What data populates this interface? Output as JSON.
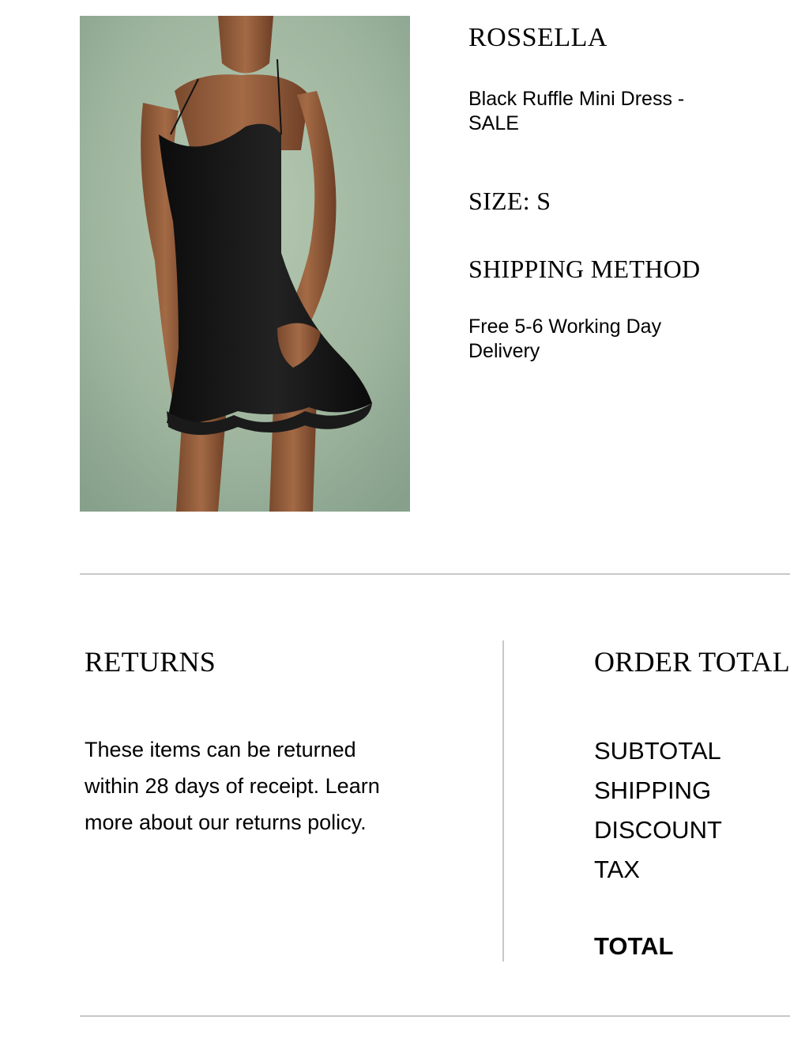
{
  "product": {
    "brand": "ROSSELLA",
    "name": "Black Ruffle Mini Dress - SALE",
    "size": "SIZE: S",
    "image": {
      "subject": "black-ruffle-mini-dress-photo",
      "background_color": "#9fb7a2",
      "dress_color": "#141414"
    }
  },
  "shipping": {
    "heading": "SHIPPING METHOD",
    "method": "Free 5-6 Working Day Delivery"
  },
  "returns": {
    "heading": "RETURNS",
    "text": "These items can be returned within 28 days of receipt. Learn more about our returns policy."
  },
  "order": {
    "heading": "ORDER TOTAL",
    "lines": [
      {
        "label": "SUBTOTAL"
      },
      {
        "label": "SHIPPING"
      },
      {
        "label": "DISCOUNT"
      },
      {
        "label": "TAX"
      }
    ],
    "total_label": "TOTAL"
  },
  "colors": {
    "text": "#000000",
    "divider": "#c8c8c8",
    "background": "#ffffff"
  }
}
